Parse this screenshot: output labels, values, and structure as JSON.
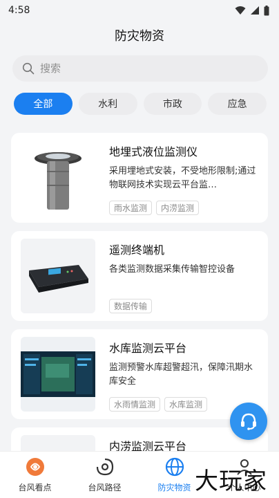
{
  "status_bar": {
    "time": "4:58"
  },
  "page": {
    "title": "防灾物资"
  },
  "search": {
    "placeholder": "搜索"
  },
  "tabs": [
    {
      "label": "全部",
      "active": true
    },
    {
      "label": "水利",
      "active": false
    },
    {
      "label": "市政",
      "active": false
    },
    {
      "label": "应急",
      "active": false
    }
  ],
  "products": [
    {
      "name": "地埋式液位监测仪",
      "desc": "采用埋地式安装，不受地形限制;通过物联网技术实现云平台监…",
      "tags": [
        "雨水监测",
        "内涝监测"
      ]
    },
    {
      "name": "遥测终端机",
      "desc": "各类监测数据采集传输智控设备",
      "tags": [
        "数据传输"
      ]
    },
    {
      "name": "水库监测云平台",
      "desc": "监测预警水库超警超汛，保障汛期水库安全",
      "tags": [
        "水雨情监测",
        "水库监测"
      ]
    },
    {
      "name": "内涝监测云平台",
      "desc": "",
      "tags": []
    }
  ],
  "bottom_nav": [
    {
      "label": "台风看点",
      "icon": "typhoon-watch-icon",
      "active": false
    },
    {
      "label": "台风路径",
      "icon": "typhoon-path-icon",
      "active": false
    },
    {
      "label": "防灾物资",
      "icon": "globe-icon",
      "active": true
    },
    {
      "label": "个人中心",
      "icon": "user-icon",
      "active": false
    }
  ],
  "watermark": "大玩家",
  "colors": {
    "accent": "#1b7ff0",
    "fab": "#2f93f0"
  }
}
